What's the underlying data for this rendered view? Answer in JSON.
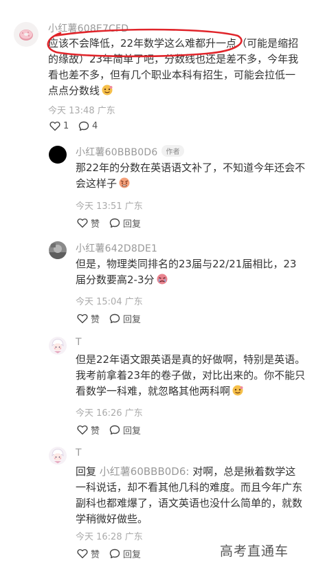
{
  "main": {
    "username": "小红薯608E7CFD",
    "text": "应该不会降低，22年数学这么难都升一点（可能是缩招的缘故）23年简单了吧，分数线也还是差不多，今年我看也差不多，但有几个职业本科有招生，可能会拉低一点点分数线",
    "time": "今天 13:48",
    "location": "广东",
    "likes": "1",
    "comments": "4"
  },
  "replies": [
    {
      "username": "小红薯60BBB0D6",
      "author_tag": "作者",
      "text": "那22年的分数在英语语文补了，不知道今年还会不会这样子",
      "time": "今天 13:51",
      "location": "广东",
      "like_label": "赞",
      "reply_label": "回复"
    },
    {
      "username": "小红薯642D8DE1",
      "text": "但是，物理类同排名的23届与22/21届相比，23届分数要高2-3分",
      "time": "今天 15:04",
      "location": "广东",
      "like_label": "赞",
      "reply_label": "回复"
    },
    {
      "username": "T",
      "text": "但是22年语文跟英语是真的好做啊，特别是英语。我考前拿着23年的卷子做，对比出来的。你不能只看数学一科难，就忽略其他两科啊",
      "time": "今天 16:26",
      "location": "广东",
      "like_label": "赞",
      "reply_label": "回复"
    },
    {
      "username": "T",
      "reply_prefix": "回复",
      "reply_target": "小红薯60BBB0D6:",
      "text": "对啊，总是揪着数学这一科说话，却不看其他几科的难度。而且今年广东副科也都难爆了，语文英语也没什么简单的，就数学稍微好做些。",
      "time": "今天 16:28",
      "location": "广东",
      "like_label": "赞",
      "reply_label": "回复"
    }
  ],
  "watermark": "高考直通车",
  "colors": {
    "annotation_red": "#e0242a",
    "meta_gray": "#aaaaaa",
    "name_gray": "#999999",
    "text": "#333333"
  },
  "icons": [
    "donut-avatar",
    "heart-icon",
    "comment-bubble-icon",
    "emoji-face-icon",
    "anime-avatar"
  ]
}
